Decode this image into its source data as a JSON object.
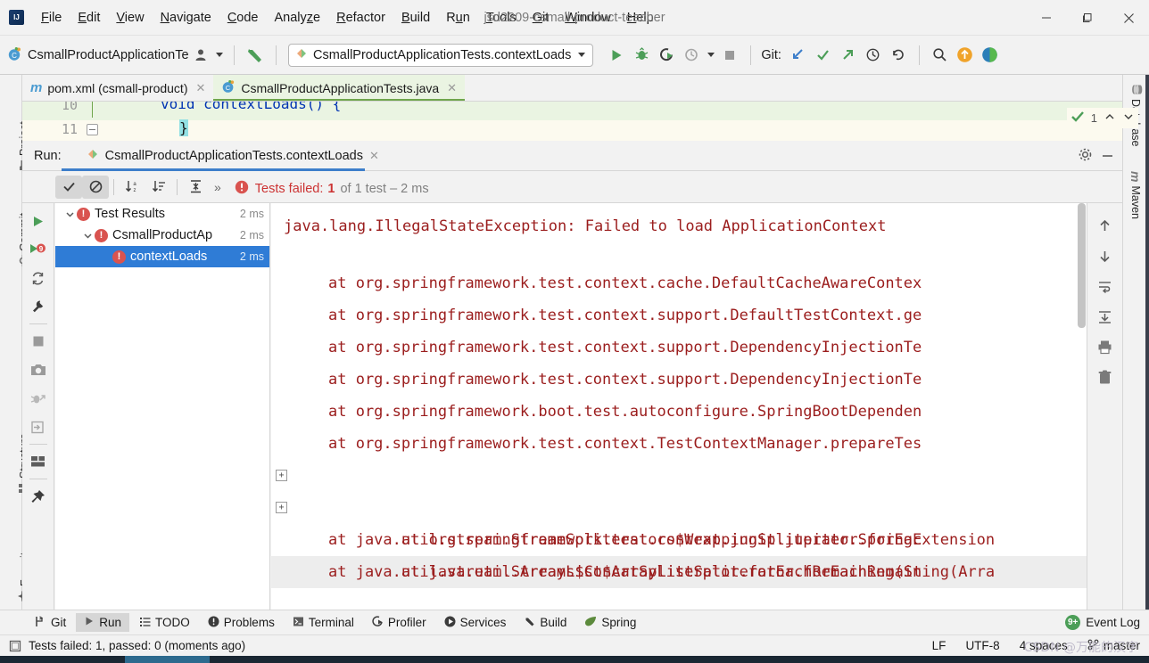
{
  "window": {
    "title": "jsd2209-csmall-product-teacher",
    "logo_icon": "intellij-logo-icon",
    "controls": [
      {
        "name": "minimize-button",
        "icon": "minimize-icon"
      },
      {
        "name": "maximize-button",
        "icon": "maximize-icon"
      },
      {
        "name": "close-button",
        "icon": "close-icon"
      }
    ]
  },
  "menubar": {
    "items": [
      {
        "label": "File",
        "mnemonic": "F"
      },
      {
        "label": "Edit",
        "mnemonic": "E"
      },
      {
        "label": "View",
        "mnemonic": "V"
      },
      {
        "label": "Navigate",
        "mnemonic": "N"
      },
      {
        "label": "Code",
        "mnemonic": "C"
      },
      {
        "label": "Analyze",
        "mnemonic": "z"
      },
      {
        "label": "Refactor",
        "mnemonic": "R"
      },
      {
        "label": "Build",
        "mnemonic": "B"
      },
      {
        "label": "Run",
        "mnemonic": "u"
      },
      {
        "label": "Tools",
        "mnemonic": "T"
      },
      {
        "label": "Git",
        "mnemonic": "G"
      },
      {
        "label": "Window",
        "mnemonic": "W"
      },
      {
        "label": "Help",
        "mnemonic": "H"
      }
    ]
  },
  "toolbar": {
    "module_label": "CsmallProductApplicationTe:",
    "module_icon": "java-class-icon",
    "user_icon": "user-avatar-icon",
    "user_caret_icon": "chevron-down-icon",
    "build_icon": "build-hammer-icon",
    "run_config": {
      "icon": "junit-test-icon",
      "label": "CsmallProductApplicationTests.contextLoads",
      "caret_icon": "chevron-down-icon"
    },
    "actions": [
      {
        "name": "run-button",
        "icon": "run-play-icon"
      },
      {
        "name": "debug-button",
        "icon": "debug-bug-icon"
      },
      {
        "name": "run-with-coverage-button",
        "icon": "run-coverage-icon"
      },
      {
        "name": "profile-button",
        "icon": "profiler-icon"
      },
      {
        "name": "profile-dropdown",
        "icon": "chevron-down-icon"
      },
      {
        "name": "stop-button",
        "icon": "stop-square-icon"
      }
    ],
    "git_label": "Git:",
    "git_actions": [
      {
        "name": "git-update-button",
        "icon": "update-project-arrow-icon"
      },
      {
        "name": "git-commit-button",
        "icon": "commit-check-icon"
      },
      {
        "name": "git-push-button",
        "icon": "push-arrow-icon"
      },
      {
        "name": "git-history-button",
        "icon": "history-clock-icon"
      },
      {
        "name": "git-rollback-button",
        "icon": "rollback-undo-icon"
      }
    ],
    "right_actions": [
      {
        "name": "search-everywhere-button",
        "icon": "search-icon"
      },
      {
        "name": "update-available-button",
        "icon": "update-arrow-circle-icon"
      },
      {
        "name": "ide-assistant-button",
        "icon": "assistant-circle-icon"
      }
    ]
  },
  "left_stripe": {
    "items": [
      {
        "label": "Project",
        "icon": "project-folder-icon"
      },
      {
        "label": "Commit",
        "icon": "commit-icon"
      },
      {
        "label": "Structure",
        "icon": "structure-icon"
      },
      {
        "label": "Favorites",
        "icon": "favorites-star-icon"
      }
    ]
  },
  "right_stripe": {
    "items": [
      {
        "label": "Database",
        "icon": "database-icon"
      },
      {
        "label": "Maven",
        "icon": "maven-m-icon"
      }
    ]
  },
  "editor_tabs": [
    {
      "label": "pom.xml (csmall-product)",
      "icon": "maven-m-icon",
      "active": false,
      "close_icon": "close-icon"
    },
    {
      "label": "CsmallProductApplicationTests.java",
      "icon": "java-class-icon",
      "active": true,
      "close_icon": "close-icon"
    }
  ],
  "editor": {
    "line_number_prev": "10",
    "line_number": "11",
    "code_prev": "void contextLoads() {",
    "code_current": "}",
    "inspection_count": "1",
    "inspection_icon": "inspection-check-icon",
    "prev_issue_icon": "chevron-up-icon",
    "next_issue_icon": "chevron-down-icon"
  },
  "run_window": {
    "label": "Run:",
    "tab": {
      "icon": "junit-test-icon",
      "label": "CsmallProductApplicationTests.contextLoads",
      "close_icon": "close-icon"
    },
    "settings_icon": "gear-icon",
    "hide_icon": "minimize-icon",
    "toolbar": {
      "left_actions": [
        {
          "name": "rerun-button",
          "icon": "run-play-icon"
        },
        {
          "name": "rerun-failed-tests-button",
          "icon": "rerun-failed-icon"
        },
        {
          "name": "toggle-auto-test-button",
          "icon": "auto-test-refresh-icon"
        },
        {
          "name": "test-settings-button",
          "icon": "wrench-icon"
        },
        {
          "name": "stop-button",
          "icon": "stop-square-icon"
        },
        {
          "name": "screenshot-button",
          "icon": "camera-icon"
        },
        {
          "name": "dump-threads-button",
          "icon": "thread-dump-icon"
        },
        {
          "name": "export-button",
          "icon": "export-icon"
        },
        {
          "name": "layout-button",
          "icon": "layout-icon"
        },
        {
          "name": "pin-tab-button",
          "icon": "pin-icon"
        }
      ],
      "top_actions": [
        {
          "name": "show-passed-toggle",
          "icon": "check-icon",
          "pressed": true
        },
        {
          "name": "show-ignored-toggle",
          "icon": "ignored-circle-slash-icon",
          "pressed": true
        },
        {
          "name": "sort-alphabetically-button",
          "icon": "sort-alpha-icon"
        },
        {
          "name": "sort-by-duration-button",
          "icon": "sort-duration-icon"
        },
        {
          "name": "expand-collapse-button",
          "icon": "expand-collapse-icon"
        },
        {
          "name": "more-actions-button",
          "icon": "chevrons-right-icon"
        }
      ],
      "status": {
        "error_icon": "error-circle-icon",
        "prefix": "Tests failed:",
        "failed_count": "1",
        "suffix": "of 1 test – 2 ms"
      }
    },
    "tree": [
      {
        "label": "Test Results",
        "duration": "2 ms",
        "indent": 0,
        "expanded": true,
        "status_icon": "error-circle-icon",
        "selected": false
      },
      {
        "label": "CsmallProductAp",
        "duration": "2 ms",
        "indent": 1,
        "expanded": true,
        "status_icon": "error-circle-icon",
        "selected": false
      },
      {
        "label": "contextLoads",
        "duration": "2 ms",
        "indent": 2,
        "expanded": null,
        "status_icon": "error-circle-icon",
        "selected": true
      }
    ],
    "console": {
      "lines": [
        {
          "text": "java.lang.IllegalStateException: Failed to load ApplicationContext",
          "indent": false,
          "fold": false,
          "highlight": false
        },
        {
          "text": "",
          "indent": false,
          "fold": false,
          "highlight": false
        },
        {
          "text": "at org.springframework.test.context.cache.DefaultCacheAwareContex",
          "indent": true,
          "fold": false,
          "highlight": false
        },
        {
          "text": "at org.springframework.test.context.support.DefaultTestContext.ge",
          "indent": true,
          "fold": false,
          "highlight": false
        },
        {
          "text": "at org.springframework.test.context.support.DependencyInjectionTe",
          "indent": true,
          "fold": false,
          "highlight": false
        },
        {
          "text": "at org.springframework.test.context.support.DependencyInjectionTe",
          "indent": true,
          "fold": false,
          "highlight": false
        },
        {
          "text": "at org.springframework.boot.test.autoconfigure.SpringBootDependen",
          "indent": true,
          "fold": false,
          "highlight": false
        },
        {
          "text": "at org.springframework.test.context.TestContextManager.prepareTes",
          "indent": true,
          "fold": false,
          "highlight": false
        },
        {
          "text": "at org.springframework.test.context.junit.jupiter.SpringExtension",
          "indent": true,
          "fold": true,
          "highlight": false
        },
        {
          "text": "at java.util.ArrayList$ArrayListSpliterator.forEachRemaining(Arra",
          "indent": true,
          "fold": true,
          "highlight": false
        },
        {
          "text": "at java.util.stream.StreamSpliterators$WrappingSpliterator.forEac",
          "indent": true,
          "fold": false,
          "highlight": false
        },
        {
          "text": "at java.util.stream.Streams$ConcatSpliterator.forEachRemaining(St",
          "indent": true,
          "fold": false,
          "highlight": true
        }
      ],
      "right_actions": [
        {
          "name": "scroll-up-button",
          "icon": "arrow-up-icon"
        },
        {
          "name": "scroll-down-button",
          "icon": "arrow-down-icon"
        },
        {
          "name": "soft-wrap-button",
          "icon": "soft-wrap-icon"
        },
        {
          "name": "scroll-to-end-button",
          "icon": "scroll-end-icon"
        },
        {
          "name": "print-button",
          "icon": "print-icon"
        },
        {
          "name": "clear-all-button",
          "icon": "trash-icon"
        }
      ]
    }
  },
  "tool_window_bar": {
    "items": [
      {
        "label": "Git",
        "icon": "git-branch-icon",
        "active": false
      },
      {
        "label": "Run",
        "icon": "run-play-icon",
        "active": true
      },
      {
        "label": "TODO",
        "icon": "todo-list-icon",
        "active": false
      },
      {
        "label": "Problems",
        "icon": "problems-warning-icon",
        "active": false
      },
      {
        "label": "Terminal",
        "icon": "terminal-icon",
        "active": false
      },
      {
        "label": "Profiler",
        "icon": "profiler-icon",
        "active": false
      },
      {
        "label": "Services",
        "icon": "services-icon",
        "active": false
      },
      {
        "label": "Build",
        "icon": "build-hammer-icon",
        "active": false
      },
      {
        "label": "Spring",
        "icon": "spring-leaf-icon",
        "active": false
      }
    ],
    "event_log": {
      "label": "Event Log",
      "badge": "9+",
      "icon": "event-log-icon"
    }
  },
  "status_bar": {
    "icon": "status-message-icon",
    "message": "Tests failed: 1, passed: 0 (moments ago)",
    "line_separator": "LF",
    "encoding": "UTF-8",
    "indent": "4 spaces",
    "branch": "master",
    "branch_icon": "git-branch-icon"
  },
  "watermark": "CSDN @万能的汉字"
}
